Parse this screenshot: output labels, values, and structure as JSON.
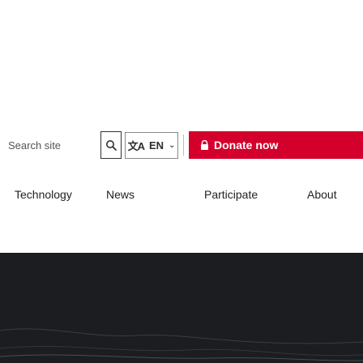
{
  "search": {
    "placeholder": "Search site"
  },
  "icons": {
    "search": "search-icon",
    "language": "translate-icon",
    "chevron": "chevron-down-icon",
    "lock": "lock-icon"
  },
  "language": {
    "icon": "文A",
    "label": "EN"
  },
  "donate": {
    "label": "Donate now"
  },
  "nav": {
    "items": [
      {
        "label": "Technology"
      },
      {
        "label": "News"
      },
      {
        "label": "Participate"
      },
      {
        "label": "About"
      }
    ]
  },
  "colors": {
    "donate": "#d3002c",
    "hero_bg": "#1b1d20"
  }
}
